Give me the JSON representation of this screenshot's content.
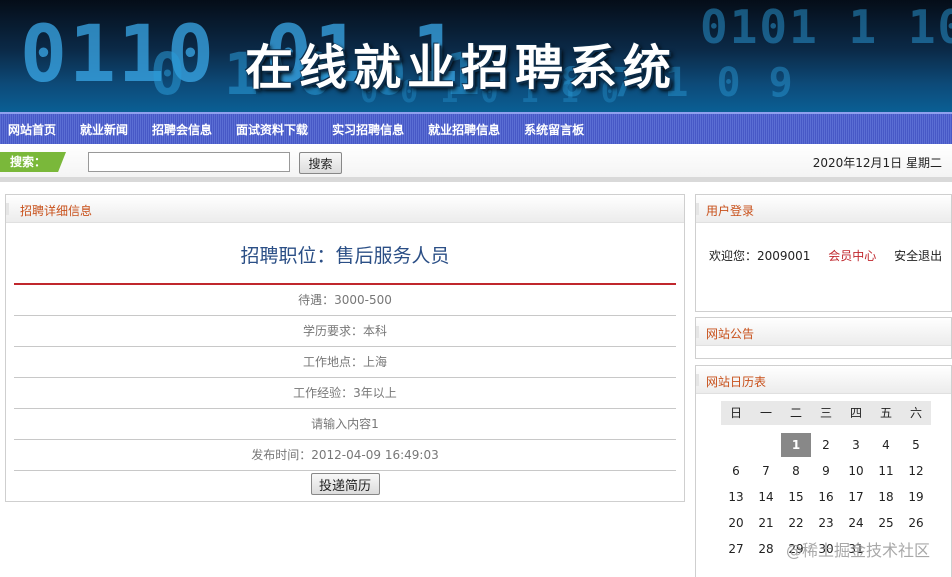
{
  "banner": {
    "title": "在线就业招聘系统"
  },
  "nav": {
    "items": [
      "网站首页",
      "就业新闻",
      "招聘会信息",
      "面试资料下载",
      "实习招聘信息",
      "就业招聘信息",
      "系统留言板"
    ]
  },
  "search": {
    "label": "搜索：",
    "placeholder": "",
    "button": "搜索"
  },
  "date": "2020年12月1日 星期二",
  "detail": {
    "header": "招聘详细信息",
    "job_title": "招聘职位：售后服务人员",
    "rows": [
      "待遇：3000-500",
      "学历要求：本科",
      "工作地点：上海",
      "工作经验：3年以上",
      "请输入内容1",
      "发布时间：2012-04-09 16:49:03"
    ],
    "apply_button": "投递简历"
  },
  "login": {
    "header": "用户登录",
    "welcome": "欢迎您：2009001",
    "member_center": "会员中心",
    "logout": "安全退出"
  },
  "notice": {
    "header": "网站公告"
  },
  "calendar": {
    "header": "网站日历表",
    "weekdays": [
      "日",
      "一",
      "二",
      "三",
      "四",
      "五",
      "六"
    ],
    "weeks": [
      [
        "",
        "",
        "1",
        "2",
        "3",
        "4",
        "5"
      ],
      [
        "6",
        "7",
        "8",
        "9",
        "10",
        "11",
        "12"
      ],
      [
        "13",
        "14",
        "15",
        "16",
        "17",
        "18",
        "19"
      ],
      [
        "20",
        "21",
        "22",
        "23",
        "24",
        "25",
        "26"
      ],
      [
        "27",
        "28",
        "29",
        "30",
        "31",
        "",
        ""
      ]
    ],
    "today": "1"
  },
  "watermark": "@稀土掘金技术社区"
}
